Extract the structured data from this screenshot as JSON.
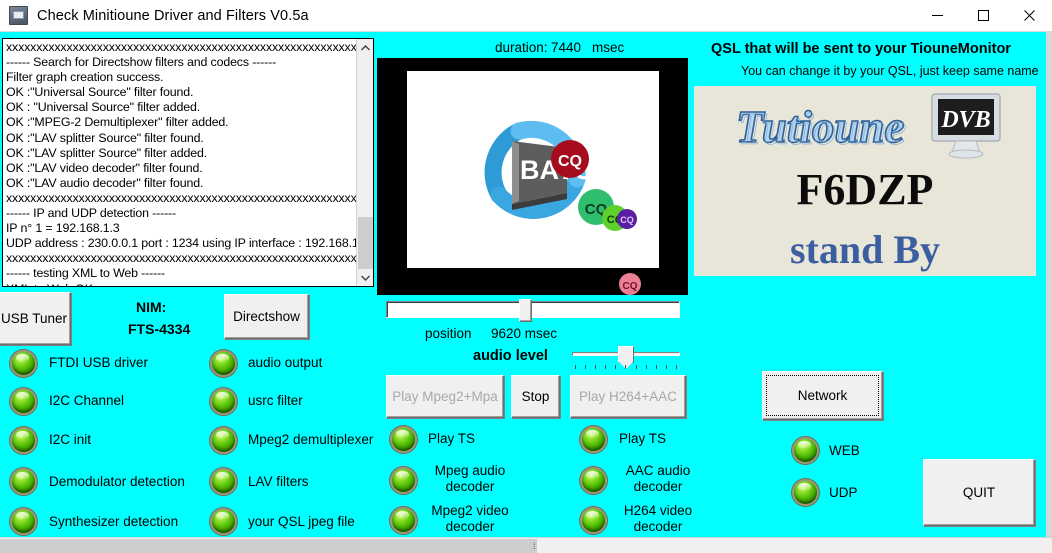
{
  "window": {
    "title": "Check Minitioune Driver and Filters V0.5a",
    "icon": "app-icon",
    "minimize_label": "minimize-icon",
    "maximize_label": "maximize-icon",
    "close_label": "close-icon"
  },
  "log": {
    "text": "xxxxxxxxxxxxxxxxxxxxxxxxxxxxxxxxxxxxxxxxxxxxxxxxxxxxxxxxxxxxxxxxxxxxxx\n------ Search for Directshow filters and codecs ------\nFilter graph creation success.\nOK :\"Universal Source\" filter found.\nOK : \"Universal Source\" filter added.\nOK :\"MPEG-2 Demultiplexer\" filter added.\nOK :\"LAV splitter Source\" filter found.\nOK :\"LAV splitter Source\" filter added.\nOK :\"LAV video decoder\" filter found.\nOK :\"LAV audio decoder\" filter found.\nxxxxxxxxxxxxxxxxxxxxxxxxxxxxxxxxxxxxxxxxxxxxxxxxxxxxxxxxxxxxxxxxxxxxxx\n------ IP and UDP detection ------\nIP n° 1 = 192.168.1.3\nUDP address : 230.0.0.1 port : 1234 using IP interface : 192.168.1.3\nxxxxxxxxxxxxxxxxxxxxxxxxxxxxxxxxxxxxxxxxxxxxxxxxxxxxxxxxxxxxxxxxxxxxxx\n------ testing XML to Web ------\nXML to Web OK"
  },
  "left": {
    "usb_tuner_button": "USB Tuner",
    "nim_label": "NIM:",
    "nim_value": "FTS-4334",
    "directshow_button": "Directshow",
    "leds_col1": [
      "FTDI USB driver",
      "I2C Channel",
      "I2C init",
      "Demodulator detection",
      "Synthesizer detection"
    ],
    "leds_col2": [
      "audio output",
      "usrc filter",
      "Mpeg2 demultiplexer",
      "LAV filters",
      "your QSL jpeg file"
    ]
  },
  "center": {
    "duration_label": "duration:",
    "duration_value": "7440",
    "duration_unit": "msec",
    "position_label": "position",
    "position_value": "9620 msec",
    "audio_level_label": "audio level",
    "play_mpeg2_button": "Play Mpeg2+Mpa",
    "stop_button": "Stop",
    "play_h264_button": "Play H264+AAC",
    "play_ts_left": "Play TS",
    "play_ts_right": "Play TS",
    "mpeg_audio_decoder": "Mpeg audio\ndecoder",
    "mpeg2_video_decoder": "Mpeg2 video\ndecoder",
    "aac_audio_decoder": "AAC audio\ndecoder",
    "h264_video_decoder": "H264 video\ndecoder",
    "video_logo_text": "BATC",
    "cq_bubbles": [
      "CQ",
      "CQ",
      "CQ",
      "CQ",
      "CQ"
    ]
  },
  "right": {
    "qsl_heading": "QSL that will be sent to your TiouneMonitor",
    "qsl_subheading": "You can change it by your QSL, just keep same name",
    "qsl_logo_text": "Tutioune",
    "qsl_logo_badge": "DVB",
    "qsl_callsign": "F6DZP",
    "qsl_status": "stand By",
    "network_button": "Network",
    "web_label": "WEB",
    "udp_label": "UDP",
    "quit_button": "QUIT"
  },
  "colors": {
    "background": "#00ffff",
    "qsl_panel": "#e8e6d8",
    "led_on": "#46b400",
    "button_face": "#f0f0f0",
    "callsign_blue": "#3b5f9e"
  }
}
